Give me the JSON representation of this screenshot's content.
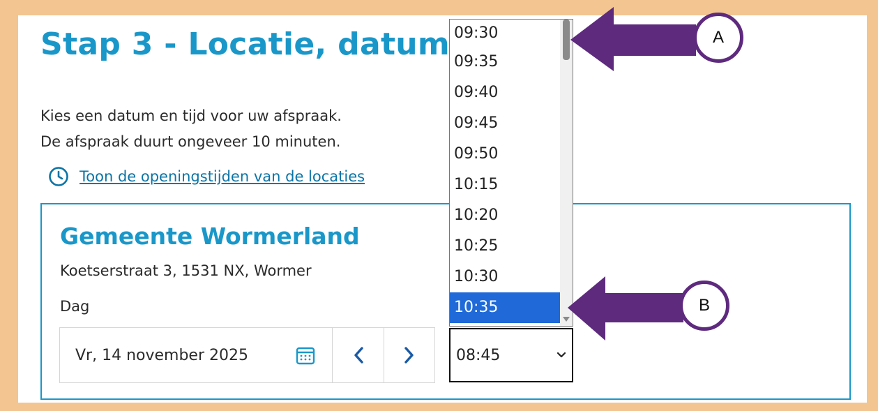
{
  "page": {
    "title": "Stap 3 - Locatie, datum en tijd",
    "intro_line1": "Kies een datum en tijd voor uw afspraak.",
    "intro_line2": "De afspraak duurt ongeveer 10 minuten.",
    "hours_link": "Toon de openingstijden van de locaties"
  },
  "location": {
    "name": "Gemeente Wormerland",
    "address": "Koetserstraat 3, 1531 NX, Wormer",
    "day_label": "Dag",
    "date_value": "Vr, 14 november 2025",
    "prev_icon": "chevron-left-icon",
    "next_icon": "chevron-right-icon"
  },
  "time_select": {
    "value": "08:45",
    "options": [
      "09:30",
      "09:35",
      "09:40",
      "09:45",
      "09:50",
      "10:15",
      "10:20",
      "10:25",
      "10:30",
      "10:35"
    ],
    "highlighted": "10:35"
  },
  "annotations": {
    "a_label": "A",
    "b_label": "B",
    "arrow_color": "#5e2a7e"
  },
  "colors": {
    "accent": "#1a97c9",
    "link": "#0b74a6",
    "border_frame": "#f3c590",
    "selected_option": "#1f6ad8"
  }
}
